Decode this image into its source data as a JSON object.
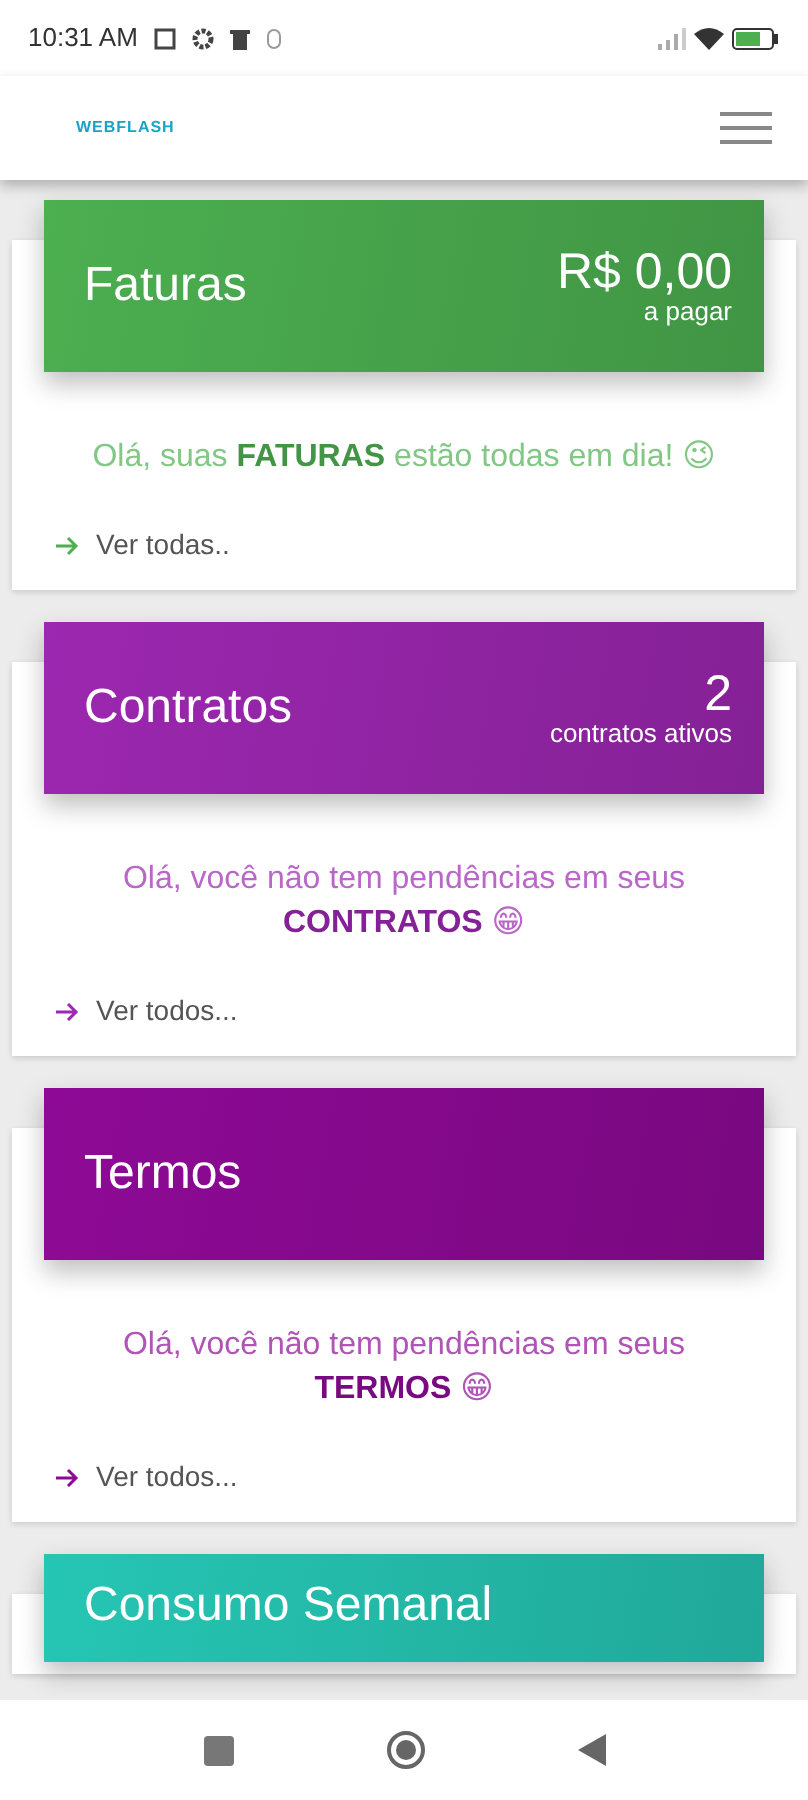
{
  "status_bar": {
    "time": "10:31 AM"
  },
  "header": {
    "logo": "WEBFLASH"
  },
  "cards": [
    {
      "title": "Faturas",
      "color": "#4caf50",
      "value": "R$ 0,00",
      "value_caption": "a pagar",
      "message": "Olá, suas **FATURAS** estão todas em dia! 😉",
      "link": "Ver todas.."
    },
    {
      "title": "Contratos",
      "color": "#9c27b0",
      "value": "2",
      "value_caption": "contratos ativos",
      "message": "Olá, você não tem pendências em seus **CONTRATOS** 😁",
      "link": "Ver todos..."
    },
    {
      "title": "Termos",
      "color": "#8e0a96",
      "message": "Olá, você não tem pendências em seus **TERMOS** 😁",
      "link": "Ver todos..."
    },
    {
      "title": "Consumo Semanal",
      "color": "#26c6b4"
    }
  ]
}
